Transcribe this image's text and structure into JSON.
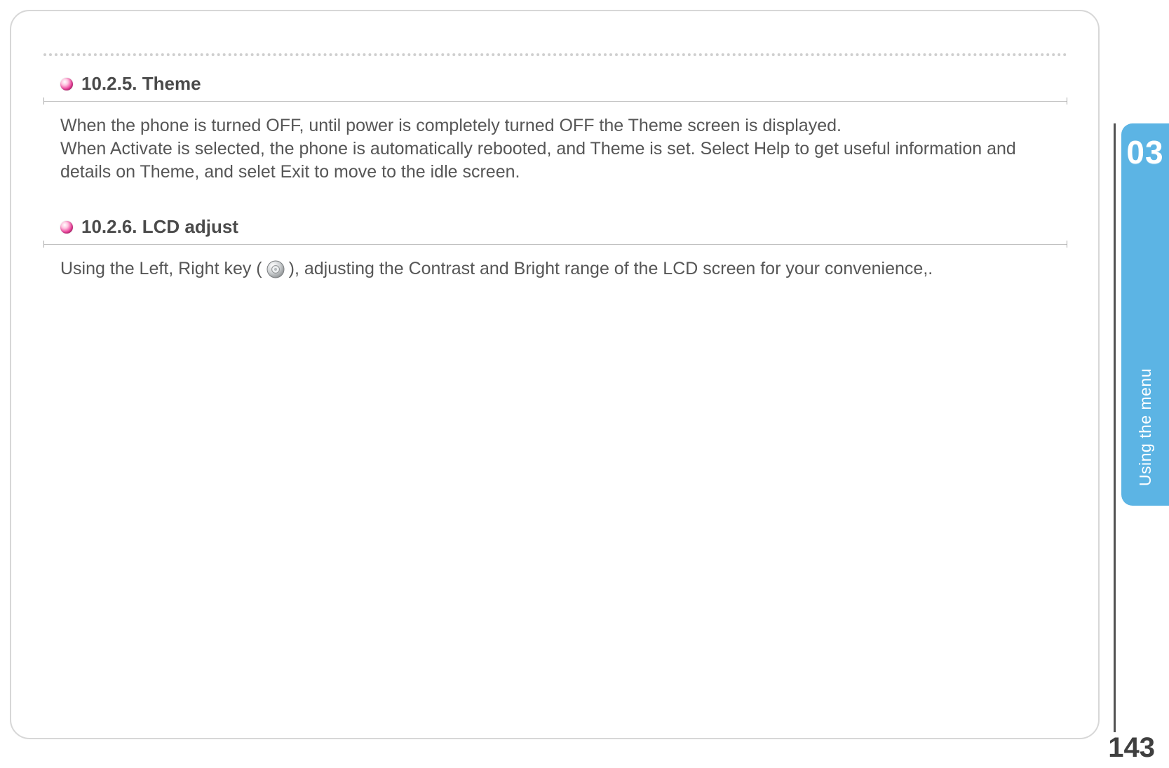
{
  "chapter": {
    "number": "03",
    "label": "Using the menu"
  },
  "page_number": "143",
  "sections": [
    {
      "title": "10.2.5. Theme",
      "body": "When the phone is turned OFF, until power is completely turned OFF the Theme screen is displayed.\nWhen Activate is selected, the phone is automatically rebooted, and Theme is set. Select Help to get useful information and details on Theme, and selet Exit to move to the idle screen."
    },
    {
      "title": "10.2.6. LCD adjust",
      "body_before": "Using the Left, Right key ( ",
      "icon": "nav-key-icon",
      "body_after": " ), adjusting the Contrast and Bright range of the LCD screen for your convenience,."
    }
  ]
}
